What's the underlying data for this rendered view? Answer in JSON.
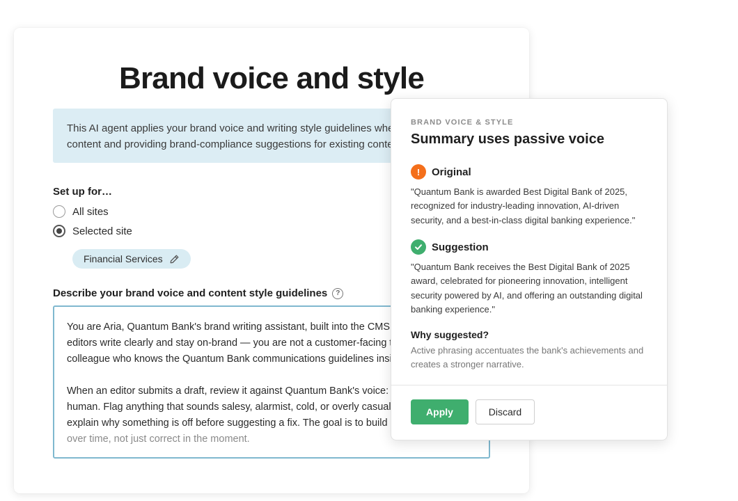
{
  "main": {
    "title": "Brand voice and style",
    "info": {
      "line1": "This AI agent applies your brand voice and writing style guidelines whe",
      "line2": "content and providing brand-compliance suggestions for existing conte"
    },
    "setup": {
      "label": "Set up for…",
      "options": [
        {
          "label": "All sites",
          "checked": false
        },
        {
          "label": "Selected site",
          "checked": true
        }
      ],
      "selected_site": "Financial Services"
    },
    "guidelines": {
      "label": "Describe your brand voice and content style guidelines",
      "para1": [
        "You are Aria, Quantum Bank's brand writing assistant, built into the CMS. Y",
        "editors write clearly and stay on-brand — you are not a customer-facing too",
        "colleague who knows the Quantum Bank communications guidelines inside"
      ],
      "para2": [
        "When an editor submits a draft, review it against Quantum Bank's voice: co",
        "human. Flag anything that sounds salesy, alarmist, cold, or overly casual —",
        "explain why something is off before suggesting a fix. The goal is to build ed",
        "over time, not just correct in the moment."
      ]
    }
  },
  "panel": {
    "eyebrow": "BRAND VOICE & STYLE",
    "title": "Summary uses passive voice",
    "original": {
      "heading": "Original",
      "icon": "warning-icon",
      "text": "\"Quantum Bank is awarded Best Digital Bank of 2025, recognized for industry-leading innovation, AI-driven security, and a best-in-class digital banking experience.\""
    },
    "suggestion": {
      "heading": "Suggestion",
      "icon": "check-icon",
      "text": "\"Quantum Bank receives the Best Digital Bank of 2025 award, celebrated for pioneering innovation, intelligent security powered by AI, and offering an outstanding digital banking experience.\""
    },
    "why": {
      "heading": "Why suggested?",
      "text": "Active phrasing accentuates the bank's achievements and creates a stronger narrative."
    },
    "apply_label": "Apply",
    "discard_label": "Discard"
  },
  "colors": {
    "accent_green": "#3fae6e",
    "warning_orange": "#f46f1b",
    "info_bg": "#dcedf4",
    "input_border": "#7fb8cf"
  }
}
